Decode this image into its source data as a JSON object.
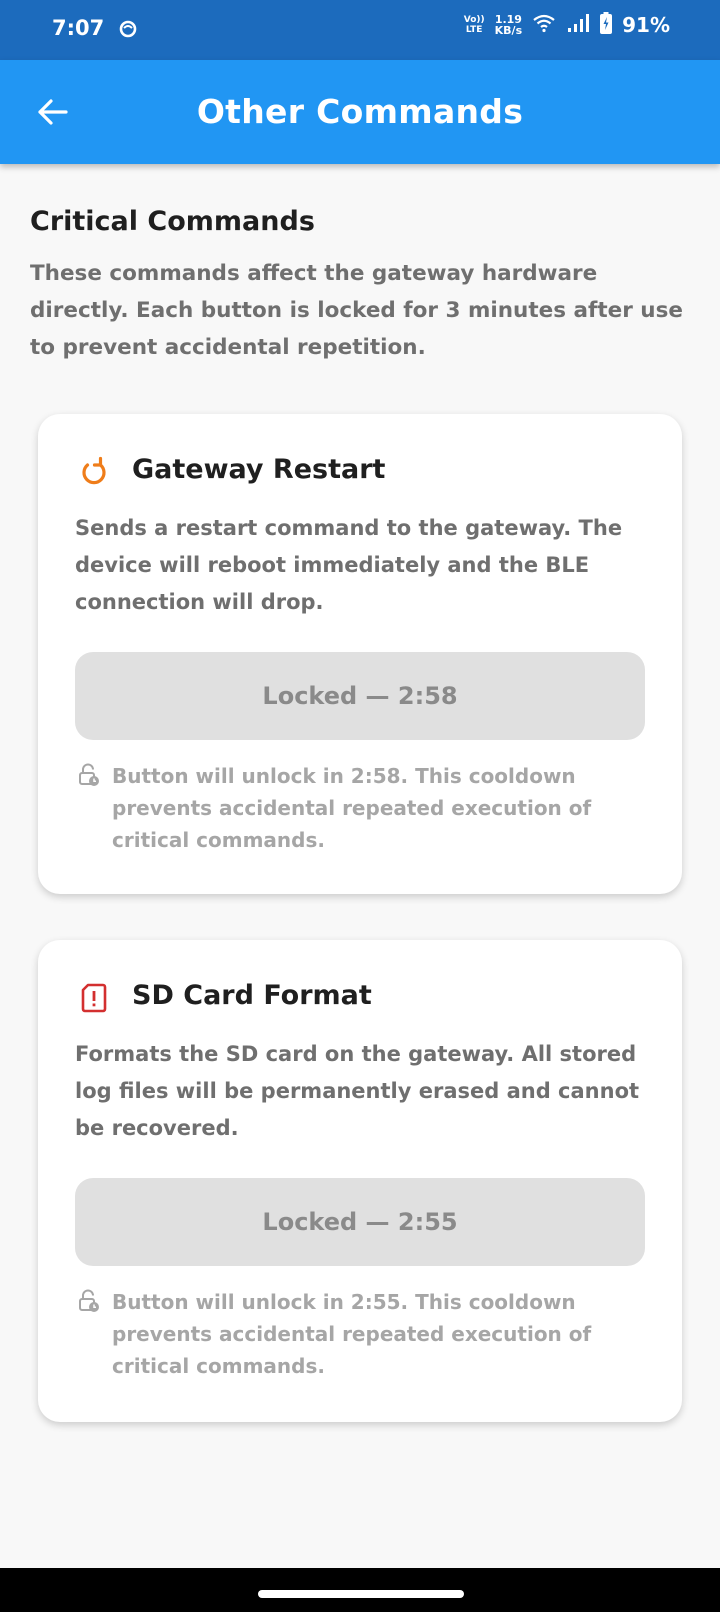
{
  "status_bar": {
    "time": "7:07",
    "volte_top": "Vo))",
    "volte_bottom": "LTE",
    "net_speed_value": "1.19",
    "net_speed_unit": "KB/s",
    "battery": "91%"
  },
  "app_bar": {
    "title": "Other Commands"
  },
  "section": {
    "title": "Critical Commands",
    "description": "These commands affect the gateway hardware directly. Each button is locked for 3 minutes after use to prevent accidental repetition."
  },
  "cards": [
    {
      "title": "Gateway Restart",
      "description": "Sends a restart command to the gateway. The device will reboot immediately and the BLE connection will drop.",
      "button_label": "Locked — 2:58",
      "cooldown_text": "Button will unlock in 2:58. This cooldown prevents accidental repeated execution of critical commands.",
      "icon": "restart-icon",
      "accent_color": "#ef7d1a"
    },
    {
      "title": "SD Card Format",
      "description": "Formats the SD card on the gateway. All stored log files will be permanently erased and cannot be recovered.",
      "button_label": "Locked — 2:55",
      "cooldown_text": "Button will unlock in 2:55. This cooldown prevents accidental repeated execution of critical commands.",
      "icon": "sd-card-alert-icon",
      "accent_color": "#d32f2f"
    }
  ],
  "colors": {
    "status_bar": "#1c6bbd",
    "app_bar": "#2196f3",
    "locked_button": "#e0e0e0"
  }
}
